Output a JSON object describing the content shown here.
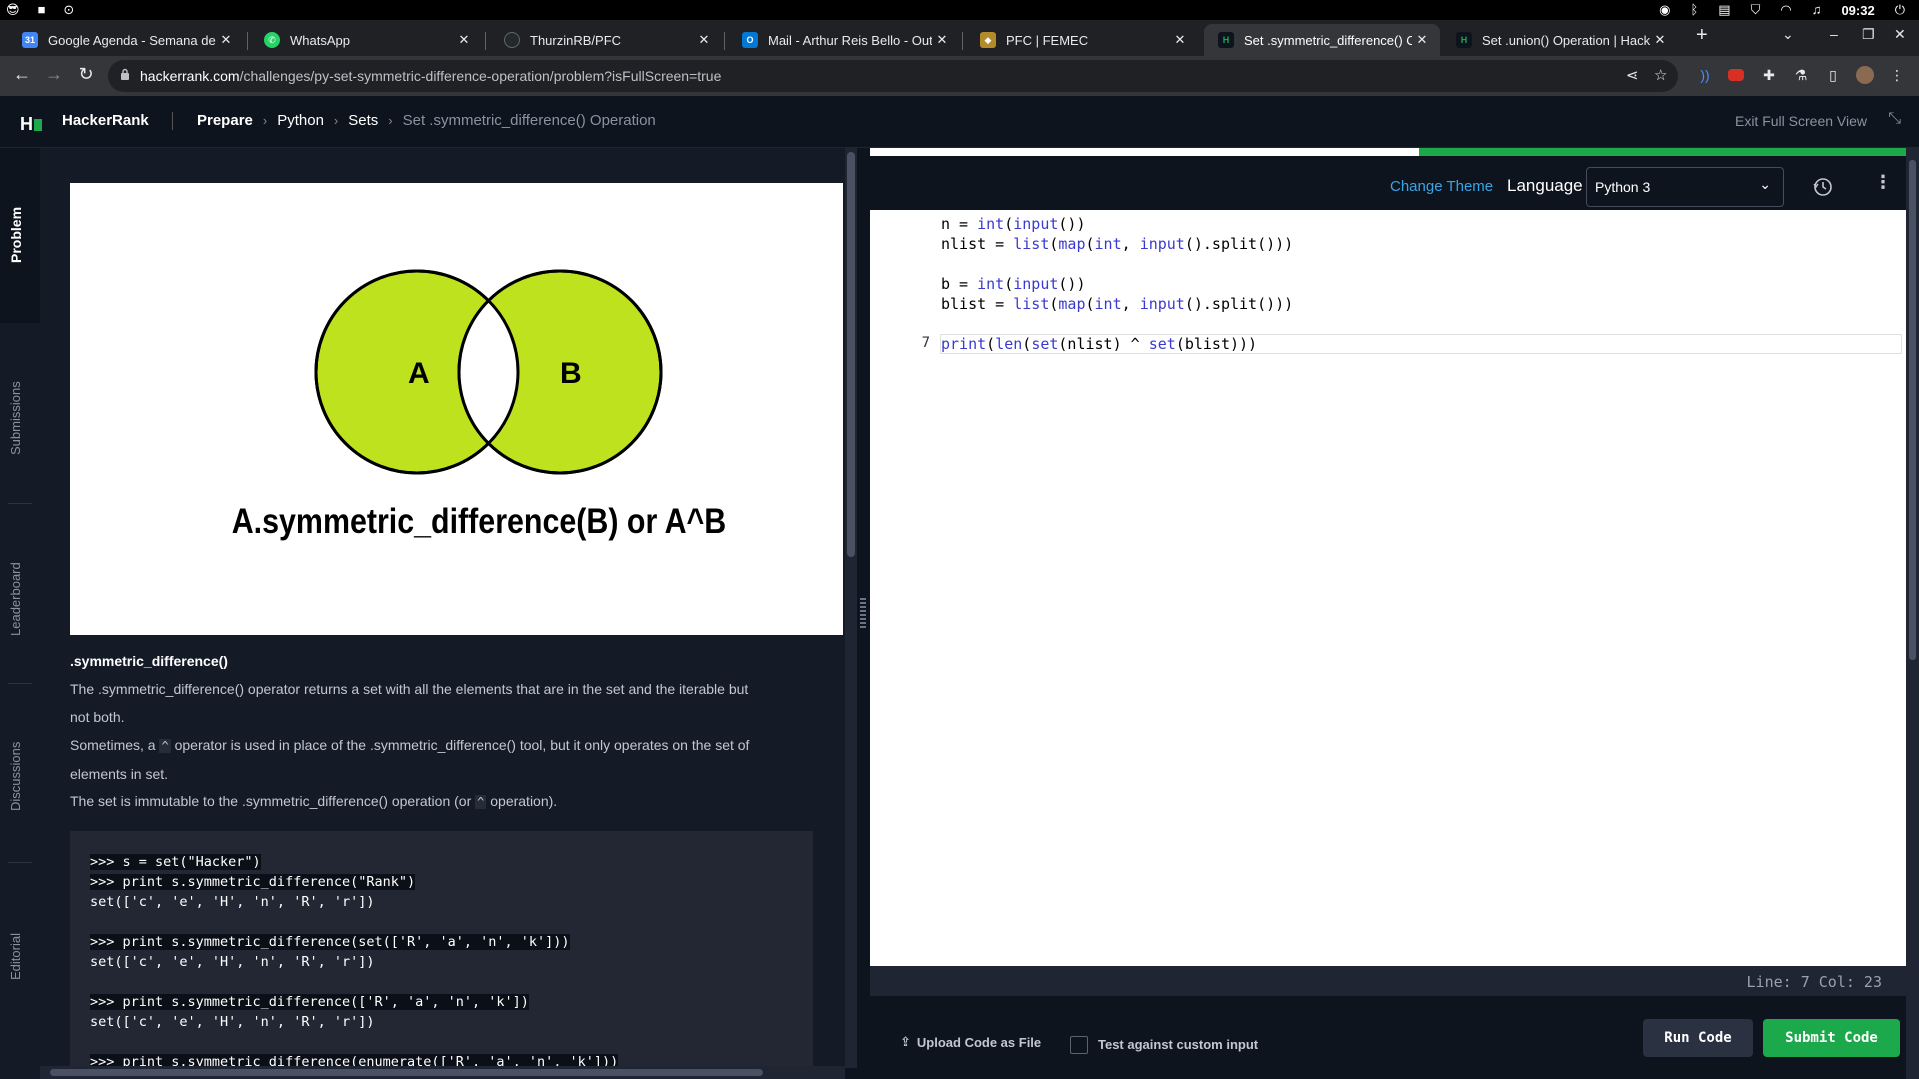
{
  "os": {
    "clock": "09:32"
  },
  "tabs": [
    {
      "title": "Google Agenda - Semana de",
      "favicon": "google-calendar-icon",
      "color": "#4285f4"
    },
    {
      "title": "WhatsApp",
      "favicon": "whatsapp-icon",
      "color": "#25d366"
    },
    {
      "title": "ThurzinRB/PFC",
      "favicon": "github-icon",
      "color": "#24292e"
    },
    {
      "title": "Mail - Arthur Reis Bello - Outl",
      "favicon": "outlook-icon",
      "color": "#0078d4"
    },
    {
      "title": "PFC | FEMEC",
      "favicon": "femec-icon",
      "color": "#b38b2b"
    },
    {
      "title": "Set .symmetric_difference() C",
      "favicon": "hackerrank-icon",
      "color": "#0e141e"
    },
    {
      "title": "Set .union() Operation | Hack",
      "favicon": "hackerrank-icon",
      "color": "#0e141e"
    }
  ],
  "address": {
    "domain": "hackerrank.com",
    "path": "/challenges/py-set-symmetric-difference-operation/problem?isFullScreen=true"
  },
  "header": {
    "brand": "HackerRank",
    "breadcrumbs": [
      "Prepare",
      "Python",
      "Sets",
      "Set .symmetric_difference() Operation"
    ],
    "exit_fullscreen": "Exit Full Screen View"
  },
  "sidenav": [
    "Problem",
    "Submissions",
    "Leaderboard",
    "Discussions",
    "Editorial"
  ],
  "problem": {
    "venn_a": "A",
    "venn_b": "B",
    "venn_caption": "A.symmetric_difference(B) or A^B",
    "heading": ".symmetric_difference()",
    "para1_a": "The .symmetric_difference() operator returns a set with all the elements that are in the set and the iterable but",
    "para1_b": "not both.",
    "para2_a_pre": "Sometimes, a ",
    "para2_a_code": "^",
    "para2_a_post": " operator is used in place of the .symmetric_difference() tool, but it only operates on the set of",
    "para2_b": "elements in set.",
    "para3_pre": "The set is immutable to the .symmetric_difference() operation (or ",
    "para3_code": "^",
    "para3_post": " operation).",
    "code_lines": [
      ">>> s = set(\"Hacker\")",
      ">>> print s.symmetric_difference(\"Rank\")",
      "set(['c', 'e', 'H', 'n', 'R', 'r'])",
      "",
      ">>> print s.symmetric_difference(set(['R', 'a', 'n', 'k']))",
      "set(['c', 'e', 'H', 'n', 'R', 'r'])",
      "",
      ">>> print s.symmetric_difference(['R', 'a', 'n', 'k'])",
      "set(['c', 'e', 'H', 'n', 'R', 'r'])",
      "",
      ">>> print s.symmetric_difference(enumerate(['R', 'a', 'n', 'k']))"
    ]
  },
  "editor": {
    "change_theme": "Change Theme",
    "language_label": "Language",
    "language_value": "Python 3",
    "current_line_number": "7",
    "status": "Line: 7 Col: 23",
    "upload": "Upload Code as File",
    "custom_input": "Test against custom input",
    "run": "Run Code",
    "submit": "Submit Code",
    "progress": 0.53
  }
}
